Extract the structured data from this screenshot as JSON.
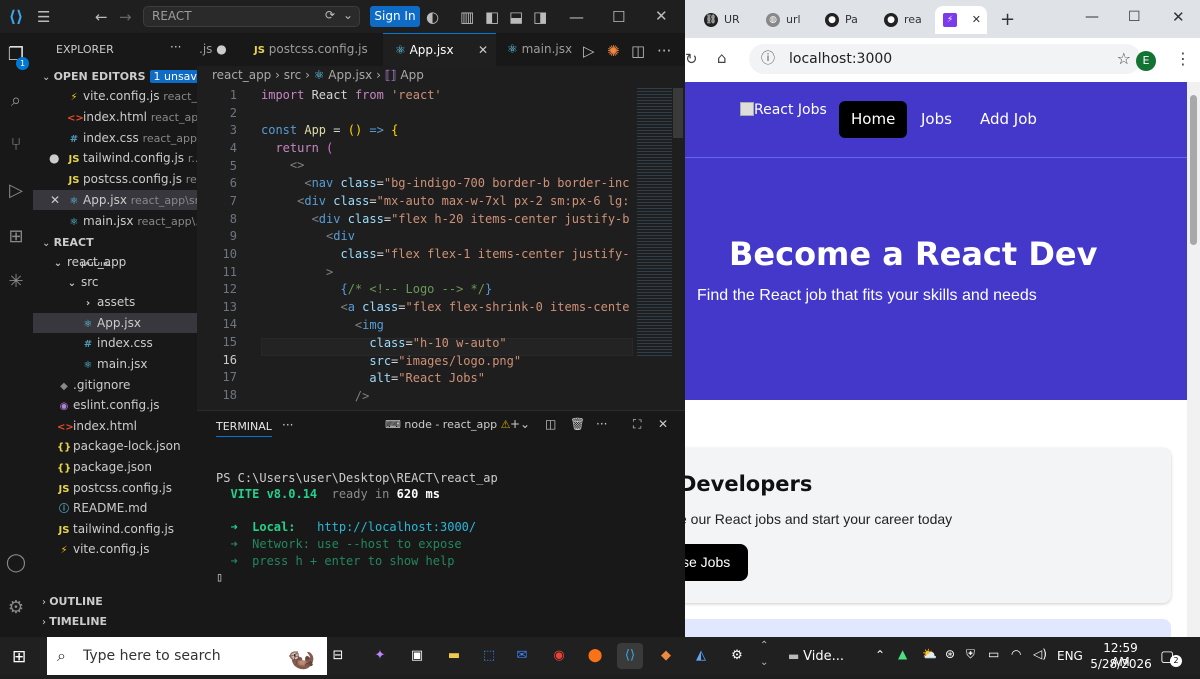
{
  "vscode": {
    "search_text": "REACT",
    "sign_in": "Sign In",
    "explorer_title": "EXPLORER",
    "open_editors": "OPEN EDITORS",
    "unsaved_badge": "1 unsaved",
    "open_files": [
      {
        "name": "vite.config.js",
        "path": "react_...",
        "icon": "⚡"
      },
      {
        "name": "index.html",
        "path": "react_app",
        "icon": "<>"
      },
      {
        "name": "index.css",
        "path": "react_app...",
        "icon": "#"
      },
      {
        "name": "tailwind.config.js",
        "path": "r...",
        "icon": "JS"
      },
      {
        "name": "postcss.config.js",
        "path": "re...",
        "icon": "JS"
      },
      {
        "name": "App.jsx",
        "path": "react_app\\src",
        "icon": "⚛"
      },
      {
        "name": "main.jsx",
        "path": "react_app\\...",
        "icon": "⚛"
      }
    ],
    "project_title": "REACT",
    "tree": [
      {
        "name": "react_app",
        "icon": "⌄"
      },
      {
        "name": "public",
        "icon": ""
      },
      {
        "name": "src",
        "icon": "⌄"
      },
      {
        "name": "assets",
        "icon": "›"
      },
      {
        "name": "App.jsx",
        "icon": "⚛"
      },
      {
        "name": "index.css",
        "icon": "#"
      },
      {
        "name": "main.jsx",
        "icon": "⚛"
      },
      {
        "name": ".gitignore",
        "icon": "◆"
      },
      {
        "name": "eslint.config.js",
        "icon": "◉"
      },
      {
        "name": "index.html",
        "icon": "<>"
      },
      {
        "name": "package-lock.json",
        "icon": "{}"
      },
      {
        "name": "package.json",
        "icon": "{}"
      },
      {
        "name": "postcss.config.js",
        "icon": "JS"
      },
      {
        "name": "README.md",
        "icon": "ⓘ"
      },
      {
        "name": "tailwind.config.js",
        "icon": "JS"
      },
      {
        "name": "vite.config.js",
        "icon": "⚡"
      }
    ],
    "outline": "OUTLINE",
    "timeline": "TIMELINE",
    "tabs": [
      ".js",
      "postcss.config.js",
      "App.jsx",
      "main.jsx"
    ],
    "breadcrumb": [
      "react_app",
      "src",
      "App.jsx",
      "App"
    ],
    "line_numbers": [
      "1",
      "2",
      "3",
      "4",
      "5",
      "6",
      "7",
      "8",
      "9",
      "10",
      "11",
      "12",
      "13",
      "14",
      "15",
      "16",
      "17",
      "18"
    ],
    "terminal_tab": "TERMINAL",
    "terminal_name": "node - react_app",
    "terminal_lines": {
      "prompt": "PS C:\\Users\\user\\Desktop\\REACT\\react_ap",
      "vite": "VITE v8.0.14",
      "ready": "ready in",
      "ready_ms": "620 ms",
      "local_label": "➜  Local:",
      "local_url": "http://localhost:3000/",
      "network": "➜  Network: use --host to expose",
      "help": "➜  press h + enter to show help"
    }
  },
  "chrome": {
    "tabs": [
      "UR",
      "url",
      "Pa",
      "rea",
      ""
    ],
    "address": "localhost:3000",
    "profile": "E",
    "logo_alt": "React Jobs",
    "nav": [
      "Home",
      "Jobs",
      "Add Job"
    ],
    "hero_title": "Become a React Dev",
    "hero_sub": "Find the React job that fits your skills and needs",
    "card_title": "Developers",
    "card_text": "e our React jobs and start your career today",
    "card_button": "se Jobs"
  },
  "taskbar": {
    "search": "Type here to search",
    "video": "Vide...",
    "lang": "ENG",
    "time": "12:59 AM",
    "date": "5/28/2026",
    "notif": "2"
  },
  "colors": {
    "accent": "#0078d4",
    "brand": "#4338ca"
  }
}
